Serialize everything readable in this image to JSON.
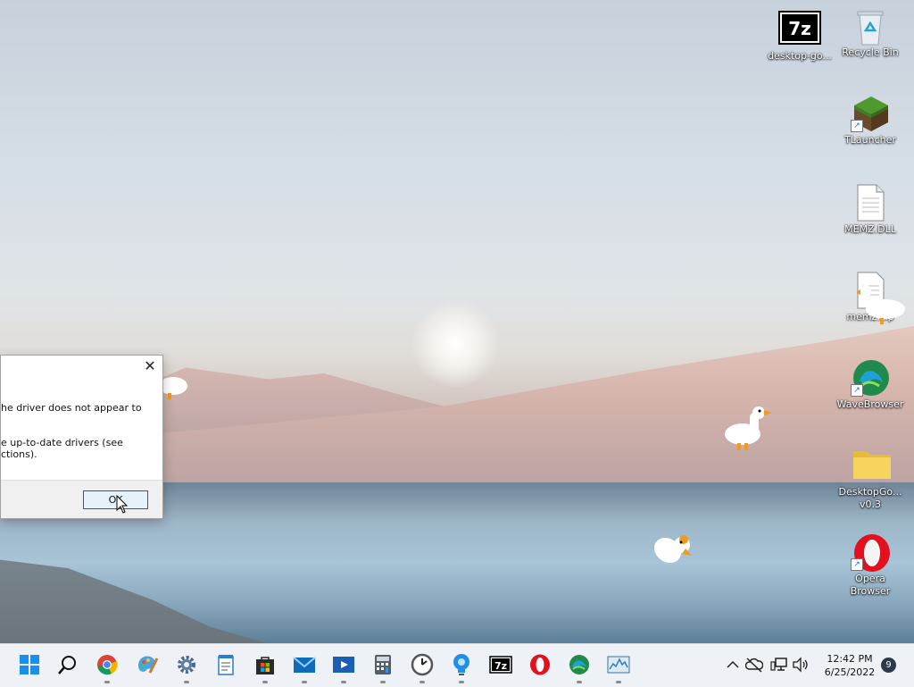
{
  "desktop": {
    "icons": [
      {
        "label": "desktop-go...",
        "icon": "7zip-icon"
      },
      {
        "label": "Recycle Bin",
        "icon": "recycle-bin-icon"
      },
      {
        "label": "TLauncher",
        "icon": "tlauncher-icon"
      },
      {
        "label": "MEMZ.DLL",
        "icon": "file-icon"
      },
      {
        "label": "memz.zip",
        "icon": "file-icon"
      },
      {
        "label": "WaveBrowser",
        "icon": "wavebrowser-icon"
      },
      {
        "label": "DesktopGo...\nv0.3",
        "icon": "folder-icon"
      },
      {
        "label": "Opera\nBrowser",
        "icon": "opera-icon"
      }
    ]
  },
  "dialog": {
    "lines": [
      "he driver does not appear to",
      "e up-to-date drivers (see\nctions)."
    ],
    "ok_label": "OK"
  },
  "taskbar": {
    "apps": [
      "start",
      "search",
      "chrome",
      "paint",
      "settings",
      "notepad",
      "store",
      "mail",
      "media-player",
      "calculator",
      "clock",
      "lightbulb-app",
      "7zip",
      "opera",
      "wavebrowser",
      "monitor"
    ],
    "time": "12:42 PM",
    "date": "6/25/2022",
    "notification_count": "9"
  }
}
